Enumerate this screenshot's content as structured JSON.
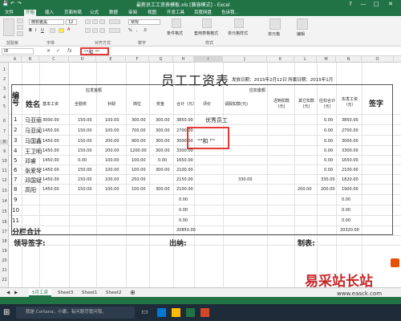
{
  "window": {
    "title": "最新员工工资表模板.xls [兼容模式] - Excel",
    "controls": [
      "?",
      "—",
      "□",
      "✕"
    ]
  },
  "ribbon": {
    "tabs": [
      "文件",
      "开始",
      "插入",
      "页面布局",
      "公式",
      "数据",
      "审阅",
      "视图",
      "开发工具",
      "百度网盘",
      "告诉我..."
    ],
    "active_tab": "开始",
    "font_name": "微软雅黑",
    "font_size": "12",
    "groups": [
      "剪贴板",
      "字体",
      "对齐方式",
      "数字",
      "样式",
      "单元格",
      "编辑"
    ],
    "number_format": "常规",
    "styles_labels": [
      "条件格式",
      "套用表格格式",
      "单元格样式"
    ],
    "cells_label": "单元格",
    "edit_label": "编辑"
  },
  "formula_bar": {
    "name_box": "I8",
    "fx": "fx",
    "content": "\"\"和 \"\""
  },
  "columns": [
    "A",
    "B",
    "C",
    "D",
    "E",
    "F",
    "G",
    "H",
    "I",
    "J",
    "K",
    "L",
    "M",
    "N",
    "O"
  ],
  "rows": [
    "1",
    "2",
    "3",
    "4",
    "5",
    "6",
    "7",
    "8",
    "9",
    "10",
    "11",
    "12",
    "13",
    "14",
    "15",
    "16",
    "17",
    "18",
    "19",
    "20",
    "21",
    "22",
    "23",
    "24"
  ],
  "sheet": {
    "title": "员工工资表",
    "release_date": "发放日期：2015年2月12日 所属日期：2015年1月",
    "headers": {
      "num": "编号",
      "name": "姓名",
      "payable": "应发金额",
      "deduct": "应扣金额",
      "total": "合计（元）",
      "rating": "评价",
      "actual_total": "实发工资（元）",
      "signature": "签字",
      "sub": [
        "基本工资",
        "全勤奖",
        "补助",
        "岗位",
        "奖金",
        "请假扣款(元)",
        "迟到扣款(元)",
        "其它扣款(元)",
        "应扣合计(元)"
      ]
    },
    "rows": [
      {
        "id": "1",
        "name": "马亚丽",
        "v": [
          "3000.00",
          "150.00",
          "100.00",
          "300.00",
          "300.00"
        ],
        "total": "3850.00",
        "rating": "优秀员工",
        "deduct_total": "0.00",
        "actual": "3850.00"
      },
      {
        "id": "2",
        "name": "马亚闻",
        "v": [
          "1450.00",
          "150.00",
          "100.00",
          "700.00",
          "300.00"
        ],
        "total": "2700.00",
        "rating": "",
        "deduct_total": "0.00",
        "actual": "2700.00"
      },
      {
        "id": "3",
        "name": "马国鑫",
        "v": [
          "1450.00",
          "150.00",
          "200.00",
          "900.00",
          "300.00"
        ],
        "total": "3000.00",
        "rating": "\"\"和 \"\"",
        "deduct_total": "0.00",
        "actual": "3000.00"
      },
      {
        "id": "4",
        "name": "王卫明",
        "v": [
          "1450.00",
          "150.00",
          "200.00",
          "1200.00",
          "300.00"
        ],
        "total": "3300.00",
        "rating": "",
        "deduct_total": "0.00",
        "actual": "3300.00"
      },
      {
        "id": "5",
        "name": "邓睿",
        "v": [
          "1450.00",
          "0.00",
          "100.00",
          "100.00",
          "0.00"
        ],
        "total": "1650.00",
        "rating": "",
        "deduct_total": "0.00",
        "actual": "1650.00"
      },
      {
        "id": "6",
        "name": "张爱琴",
        "v": [
          "1450.00",
          "150.00",
          "100.00",
          "100.00",
          "300.00"
        ],
        "total": "2100.00",
        "rating": "",
        "deduct_total": "0.00",
        "actual": "2100.00"
      },
      {
        "id": "7",
        "name": "邓国斌",
        "v": [
          "1450.00",
          "150.00",
          "100.00",
          "250.00",
          ""
        ],
        "total": "2150.00",
        "rating": "",
        "leave": "330.00",
        "deduct_total": "330.00",
        "actual": "1820.00"
      },
      {
        "id": "8",
        "name": "高阳",
        "v": [
          "1450.00",
          "150.00",
          "100.00",
          "100.00",
          "300.00"
        ],
        "total": "2100.00",
        "rating": "",
        "other": "200.00",
        "deduct_total": "200.00",
        "actual": "1900.00"
      },
      {
        "id": "9",
        "name": "",
        "v": [
          "",
          "",
          "",
          "",
          ""
        ],
        "total": "0.00",
        "rating": "",
        "deduct_total": "",
        "actual": "0.00"
      },
      {
        "id": "10",
        "name": "",
        "v": [
          "",
          "",
          "",
          "",
          ""
        ],
        "total": "0.00",
        "rating": "",
        "deduct_total": "",
        "actual": "0.00"
      },
      {
        "id": "11",
        "name": "",
        "v": [
          "",
          "",
          "",
          "",
          ""
        ],
        "total": "0.00",
        "rating": "",
        "deduct_total": "",
        "actual": "0.00"
      }
    ],
    "subtotal_label": "分栏合计",
    "subtotal_total": "20850.00",
    "subtotal_actual": "20320.00",
    "leader_sign": "领导签字:",
    "cashier": "出纳:",
    "preparer": "制表:"
  },
  "sheet_tabs": [
    "5月工资",
    "Sheet3",
    "Sheet1",
    "Sheet2"
  ],
  "active_sheet": "5月工资",
  "taskbar": {
    "search_placeholder": "我是 Cortana，小娜。有问题尽管问我。"
  },
  "watermark": {
    "text": "易采站长站",
    "url": "www.easck.com"
  },
  "colors": {
    "excel_green": "#217346",
    "highlight_red": "#e53935"
  }
}
